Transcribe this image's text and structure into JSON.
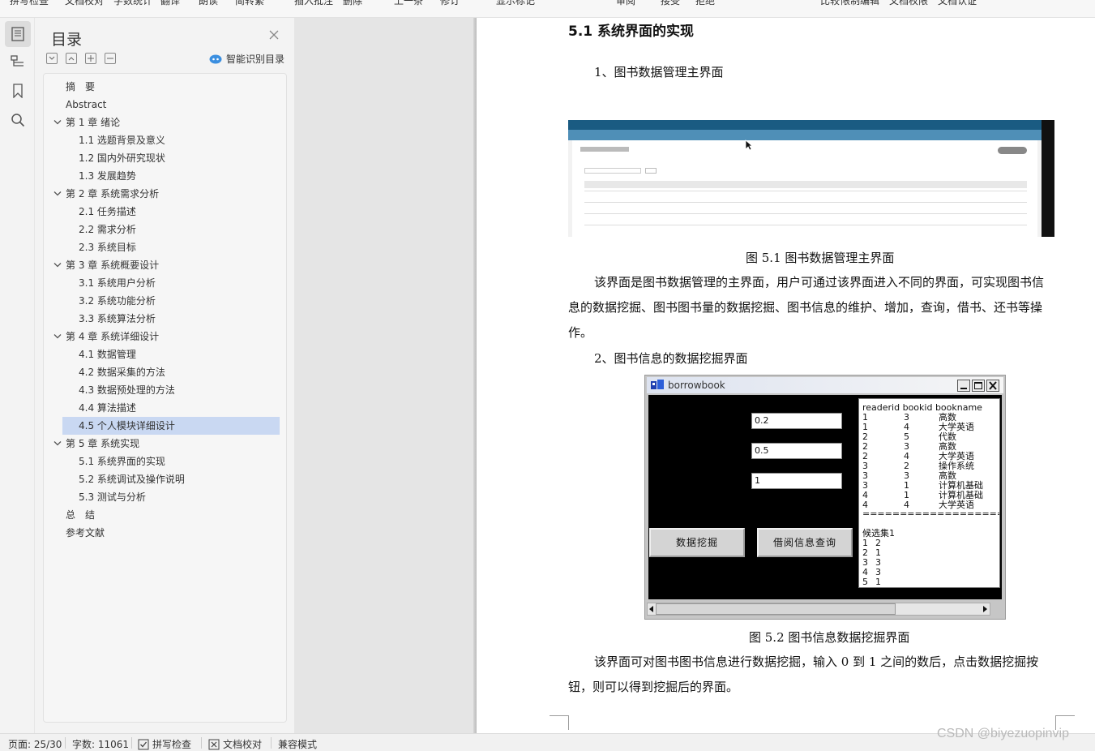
{
  "toolbar": {
    "items": [
      "拼写检查",
      "文档校对",
      "字数统计",
      "翻译",
      "朗读",
      "简转繁",
      "插入批注",
      "删除",
      "上一条",
      "修订",
      "显示标记",
      "审阅",
      "接受",
      "拒绝",
      "比较",
      "限制编辑",
      "文档权限",
      "文档认证"
    ]
  },
  "toc": {
    "title": "目录",
    "smart_label": "智能识别目录",
    "items": [
      {
        "label": "摘　要",
        "level": 1
      },
      {
        "label": "Abstract",
        "level": 1
      },
      {
        "label": "第 1 章  绪论",
        "level": 1,
        "expanded": true
      },
      {
        "label": "1.1 选题背景及意义",
        "level": 2
      },
      {
        "label": "1.2 国内外研究现状",
        "level": 2
      },
      {
        "label": "1.3 发展趋势",
        "level": 2
      },
      {
        "label": "第 2 章  系统需求分析",
        "level": 1,
        "expanded": true
      },
      {
        "label": "2.1 任务描述",
        "level": 2
      },
      {
        "label": "2.2 需求分析",
        "level": 2
      },
      {
        "label": "2.3  系统目标",
        "level": 2
      },
      {
        "label": "第 3 章  系统概要设计",
        "level": 1,
        "expanded": true
      },
      {
        "label": "3.1  系统用户分析",
        "level": 2
      },
      {
        "label": "3.2   系统功能分析",
        "level": 2
      },
      {
        "label": "3.3  系统算法分析",
        "level": 2
      },
      {
        "label": "第 4 章  系统详细设计",
        "level": 1,
        "expanded": true
      },
      {
        "label": "4.1  数据管理",
        "level": 2
      },
      {
        "label": "4.2  数据采集的方法",
        "level": 2
      },
      {
        "label": "4.3  数据预处理的方法",
        "level": 2
      },
      {
        "label": "4.4  算法描述",
        "level": 2
      },
      {
        "label": "4.5  个人模块详细设计",
        "level": 2,
        "selected": true
      },
      {
        "label": "第 5 章  系统实现",
        "level": 1,
        "expanded": true
      },
      {
        "label": "5.1  系统界面的实现",
        "level": 2
      },
      {
        "label": "5.2  系统调试及操作说明",
        "level": 2
      },
      {
        "label": "5.3  测试与分析",
        "level": 2
      },
      {
        "label": "总　结",
        "level": 1
      },
      {
        "label": "参考文献",
        "level": 1
      }
    ]
  },
  "doc": {
    "heading": "5.1  系统界面的实现",
    "sub1": "1、图书数据管理主界面",
    "caption1": "图  5.1  图书数据管理主界面",
    "para1": "该界面是图书数据管理的主界面，用户可通过该界面进入不同的界面，可实现图书信息的数据挖掘、图书图书量的数据挖掘、图书信息的维护、增加，查询，借书、还书等操作。",
    "sub2": "2、图书信息的数据挖掘界面",
    "caption2": "图  5.2  图书信息数据挖掘界面",
    "para2": "该界面可对图书图书信息进行数据挖掘，输入 0 到 1 之间的数后，点击数据挖掘按钮，则可以得到挖掘后的界面。"
  },
  "fig2": {
    "title": "borrowbook",
    "inputs": [
      "0.2",
      "0.5",
      "1"
    ],
    "btn_mine": "数据挖掘",
    "btn_query": "借阅信息查询",
    "table_header": "readerid   bookid   bookname",
    "rows": [
      [
        "1",
        "3",
        "高数"
      ],
      [
        "1",
        "4",
        "大学英语"
      ],
      [
        "2",
        "5",
        "代数"
      ],
      [
        "2",
        "3",
        "高数"
      ],
      [
        "2",
        "4",
        "大学英语"
      ],
      [
        "3",
        "2",
        "操作系统"
      ],
      [
        "3",
        "3",
        "高数"
      ],
      [
        "3",
        "1",
        "计算机基础"
      ],
      [
        "4",
        "1",
        "计算机基础"
      ],
      [
        "4",
        "4",
        "大学英语"
      ]
    ],
    "separator": "================================",
    "candidate_label": "候选集1",
    "candidates": [
      [
        "1",
        "2"
      ],
      [
        "2",
        "1"
      ],
      [
        "3",
        "3"
      ],
      [
        "4",
        "3"
      ],
      [
        "5",
        "1"
      ]
    ]
  },
  "status": {
    "page": "页面: 25/30",
    "words": "字数: 11061",
    "spell": "拼写检查",
    "proof": "文档校对",
    "compat": "兼容模式"
  },
  "watermark": "CSDN @biyezuopinvip"
}
